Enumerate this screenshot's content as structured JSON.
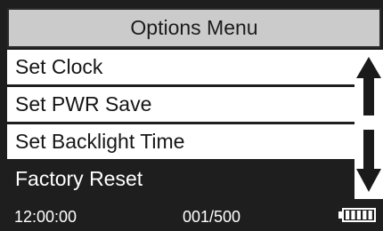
{
  "header": {
    "title": "Options Menu"
  },
  "menu": {
    "items": [
      {
        "label": "Set Clock",
        "selected": false
      },
      {
        "label": "Set PWR Save",
        "selected": false
      },
      {
        "label": "Set Backlight Time",
        "selected": false
      },
      {
        "label": "Factory Reset",
        "selected": true
      }
    ]
  },
  "scroll": {
    "up_icon": "arrow-up-icon",
    "down_icon": "arrow-down-icon"
  },
  "status": {
    "time": "12:00:00",
    "count": "001/500",
    "battery_icon": "battery-icon",
    "battery_level": 1.0
  },
  "colors": {
    "background": "#1e1e1e",
    "title_bar": "#cbcbcb",
    "menu_bg": "#ffffff",
    "text": "#ffffff"
  }
}
